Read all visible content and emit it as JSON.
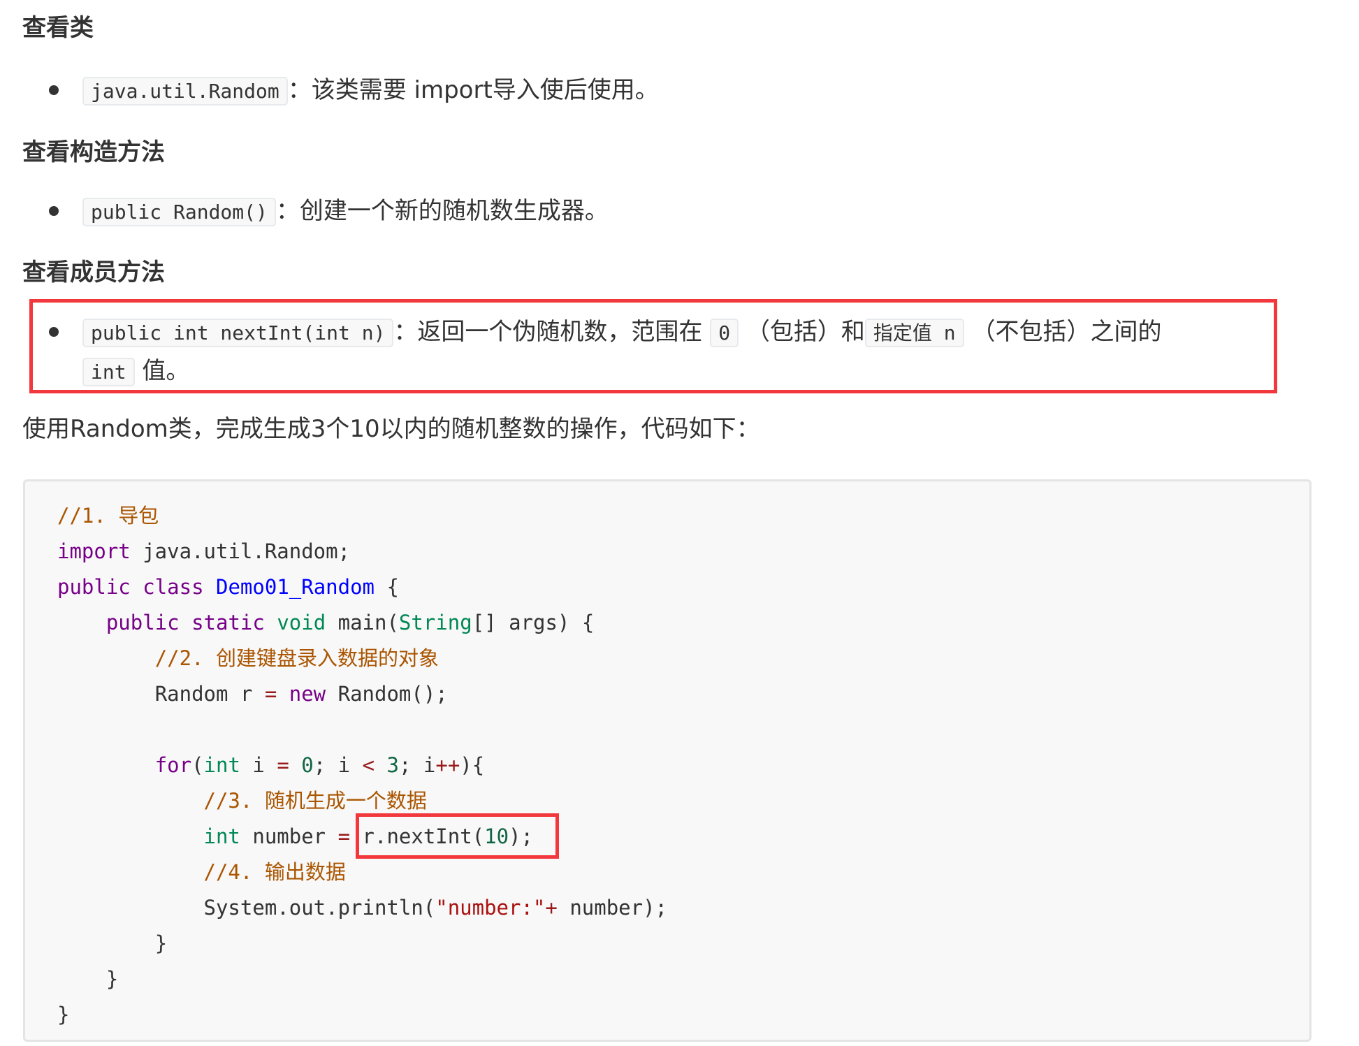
{
  "sections": [
    {
      "heading": "查看类",
      "item": {
        "code": "java.util.Random",
        "text": "：该类需要 import导入使后使用。"
      }
    },
    {
      "heading": "查看构造方法",
      "item": {
        "code": "public Random()",
        "text": "：创建一个新的随机数生成器。"
      }
    },
    {
      "heading": "查看成员方法",
      "item": {
        "code": "public int nextInt(int n)",
        "text1": "：返回一个伪随机数，范围在",
        "code_zero": "0",
        "text2": "（包括）和",
        "code_n": "指定值 n",
        "text3": "（不包括）之间的",
        "code_int": "int",
        "text4": "值。"
      }
    }
  ],
  "paragraph": "使用Random类，完成生成3个10以内的随机整数的操作，代码如下：",
  "code": {
    "comment1": "//1. 导包",
    "import_kw": "import",
    "import_rest": " java.util.Random;",
    "public_kw": "public",
    "class_kw": "class",
    "class_name": "Demo01_Random",
    "brace_open": " {",
    "static_kw": "static",
    "void_kw": "void",
    "main": " main(",
    "string_type": "String",
    "args": "[] args) {",
    "comment2": "//2. 创建键盘录入数据的对象",
    "random_decl": "Random r ",
    "eq": "=",
    "new_kw": "new",
    "random_ctor": " Random();",
    "for_kw": "for",
    "paren": "(",
    "int_kw": "int",
    "i_var": " i ",
    "zero": "0",
    "semi_i": "; i ",
    "lt": "<",
    "three": "3",
    "semi_i2": "; i",
    "plusplus": "++",
    "close_for": "){",
    "comment3": "//3. 随机生成一个数据",
    "number_decl": " number ",
    "nextint_call": " r.nextInt(",
    "ten": "10",
    "nextint_end": ");",
    "comment4": "//4. 输出数据",
    "println": "System.out.println(",
    "str": "\"number:\"",
    "plus": "+",
    "println_end": " number);",
    "close_brace": "}"
  },
  "highlight_color": "#f2383d"
}
